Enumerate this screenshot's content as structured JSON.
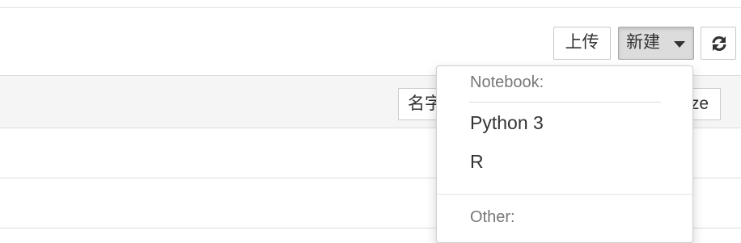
{
  "toolbar": {
    "upload_label": "上传",
    "new_label": "新建",
    "refresh_icon": "refresh-icon"
  },
  "list_header": {
    "sort_name_label": "名字",
    "sort_size_label": "ze"
  },
  "new_menu": {
    "notebook_header": "Notebook:",
    "items": [
      {
        "label": "Python 3"
      },
      {
        "label": "R"
      }
    ],
    "other_header": "Other:"
  }
}
